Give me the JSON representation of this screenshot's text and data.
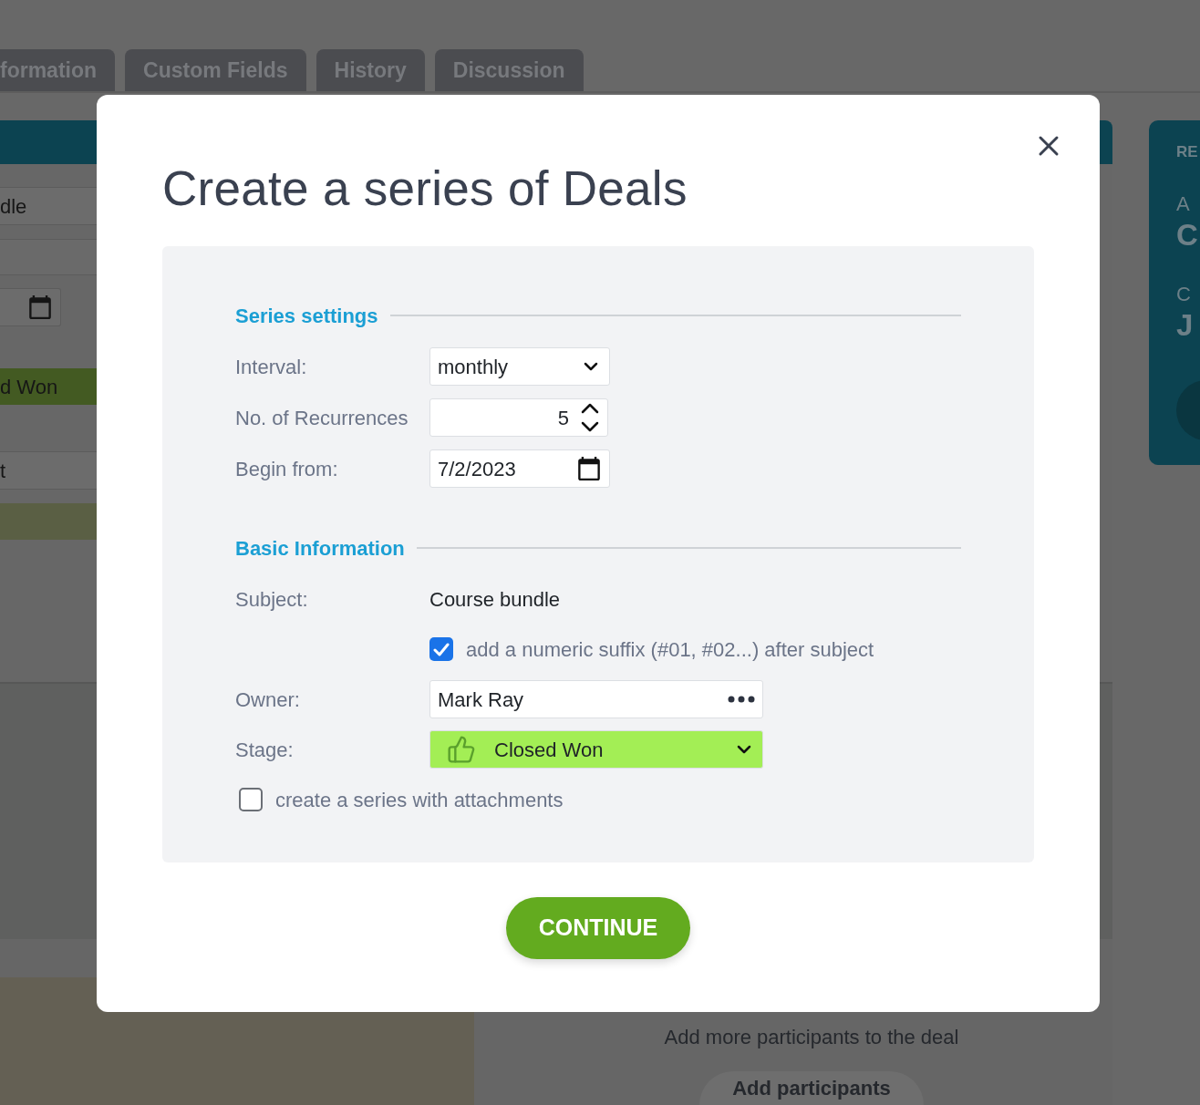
{
  "background": {
    "tabs": [
      {
        "label": "formation"
      },
      {
        "label": "Custom Fields"
      },
      {
        "label": "History"
      },
      {
        "label": "Discussion"
      }
    ],
    "fields": [
      {
        "kind": "text",
        "value": "dle"
      },
      {
        "kind": "blank"
      },
      {
        "kind": "date"
      },
      {
        "kind": "stage",
        "value": "d Won"
      },
      {
        "kind": "text",
        "value": "t"
      },
      {
        "kind": "bar"
      }
    ],
    "side_panel": [
      {
        "kind": "heading",
        "text": "RE"
      },
      {
        "kind": "label",
        "text": "A"
      },
      {
        "kind": "value",
        "text": "C"
      },
      {
        "kind": "label",
        "text": "C"
      },
      {
        "kind": "value",
        "text": "J"
      }
    ],
    "participants": {
      "text": "Add more participants to the deal",
      "button": "Add participants"
    }
  },
  "dialog": {
    "title": "Create a series of Deals",
    "sections": [
      {
        "heading": "Series settings",
        "rows": [
          {
            "kind": "select",
            "label": "Interval:",
            "value": "monthly"
          },
          {
            "kind": "number",
            "label": "No. of Recurrences",
            "value": "5"
          },
          {
            "kind": "date",
            "label": "Begin from:",
            "value": "7/2/2023"
          }
        ]
      },
      {
        "heading": "Basic Information",
        "rows": [
          {
            "kind": "text",
            "label": "Subject:",
            "value": "Course bundle"
          },
          {
            "kind": "option",
            "label": "add a numeric suffix (#01, #02...) after subject",
            "checked": true
          },
          {
            "kind": "picker",
            "label": "Owner:",
            "value": "Mark Ray"
          },
          {
            "kind": "stage",
            "label": "Stage:",
            "value": "Closed Won"
          }
        ]
      }
    ],
    "attachments": {
      "label": "create a series with attachments",
      "checked": false
    },
    "continue_button": "CONTINUE"
  }
}
